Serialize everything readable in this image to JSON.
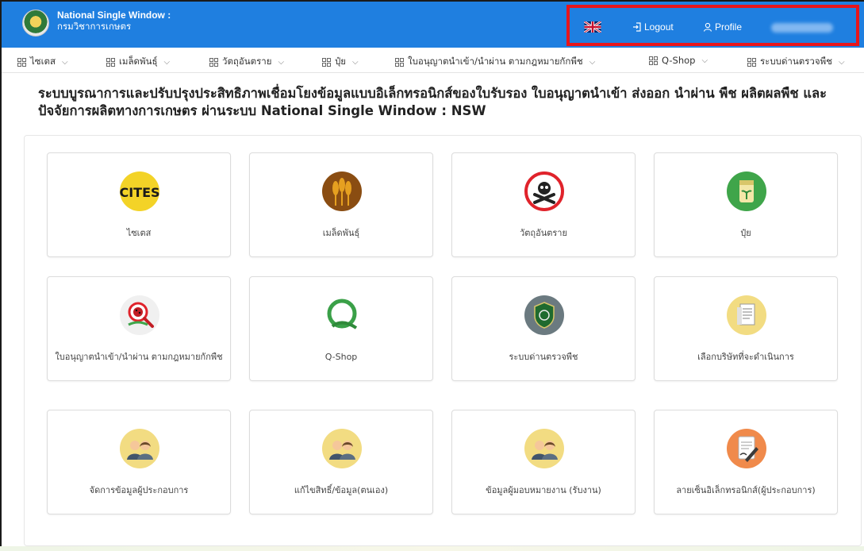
{
  "header": {
    "app_title": "National Single Window :",
    "app_subtitle": "กรมวิชาการเกษตร",
    "language_icon": "uk-flag-icon",
    "logout_label": "Logout",
    "profile_label": "Profile"
  },
  "nav": [
    {
      "label": "ไซเตส"
    },
    {
      "label": "เมล็ดพันธุ์"
    },
    {
      "label": "วัตถุอันตราย"
    },
    {
      "label": "ปุ๋ย"
    },
    {
      "label": "ใบอนุญาตนำเข้า/นำผ่าน ตามกฎหมายกักพืช"
    },
    {
      "label": "Q-Shop"
    },
    {
      "label": "ระบบด่านตรวจพืช"
    }
  ],
  "page_title": "ระบบบูรณาการและปรับปรุงประสิทธิภาพเชื่อมโยงข้อมูลแบบอิเล็กทรอนิกส์ของใบรับรอง ใบอนุญาตนำเข้า ส่งออก นำผ่าน พืช ผลิตผลพืช และปัจจัยการผลิตทางการเกษตร ผ่านระบบ National Single Window : NSW",
  "cards": [
    {
      "label": "ไซเตส",
      "icon": "cites-icon"
    },
    {
      "label": "เมล็ดพันธุ์",
      "icon": "seed-icon"
    },
    {
      "label": "วัตถุอันตราย",
      "icon": "hazard-skull-icon"
    },
    {
      "label": "ปุ๋ย",
      "icon": "fertilizer-icon"
    },
    {
      "label": "ใบอนุญาตนำเข้า/นำผ่าน ตามกฎหมายกักพืช",
      "icon": "plant-quarantine-icon"
    },
    {
      "label": "Q-Shop",
      "icon": "q-shop-icon"
    },
    {
      "label": "ระบบด่านตรวจพืช",
      "icon": "plant-checkpoint-icon"
    },
    {
      "label": "เลือกบริษัทที่จะดำเนินการ",
      "icon": "select-company-icon"
    },
    {
      "label": "จัดการข้อมูลผู้ประกอบการ",
      "icon": "manage-operator-icon"
    },
    {
      "label": "แก้ไขสิทธิ์/ข้อมูล(ตนเอง)",
      "icon": "edit-self-icon"
    },
    {
      "label": "ข้อมูลผู้มอบหมายงาน (รับงาน)",
      "icon": "assigner-info-icon"
    },
    {
      "label": "ลายเซ็นอิเล็กทรอนิกส์(ผู้ประกอบการ)",
      "icon": "e-signature-icon"
    }
  ]
}
